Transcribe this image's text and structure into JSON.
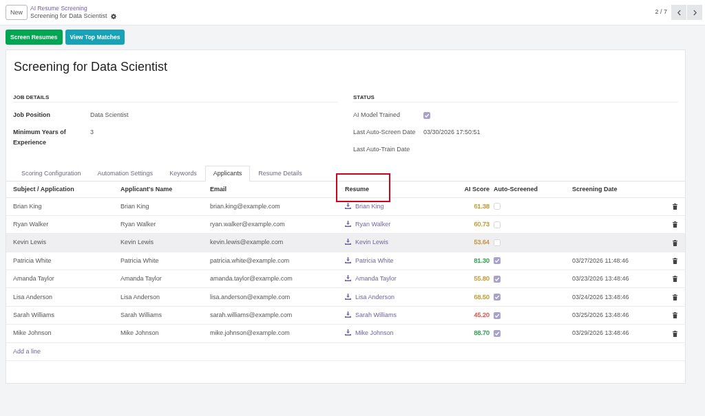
{
  "top_bar": {
    "new_button": "New",
    "breadcrumb": {
      "parent": "AI Resume Screening",
      "current": "Screening for Data Scientist"
    },
    "pager": "2 / 7"
  },
  "action_buttons": [
    {
      "label": "Screen Resumes",
      "kind": "success"
    },
    {
      "label": "View Top Matches",
      "kind": "info"
    }
  ],
  "form": {
    "title": "Screening for Data Scientist",
    "groups": [
      {
        "heading": "JOB DETAILS",
        "fields": [
          {
            "label": "Job Position",
            "kind": "text",
            "readonly": false,
            "value": "Data Scientist"
          },
          {
            "label": "Minimum Years of Experience",
            "kind": "text",
            "readonly": false,
            "value": "3"
          }
        ]
      },
      {
        "heading": "STATUS",
        "fields": [
          {
            "label": "AI Model Trained",
            "kind": "checkbox",
            "readonly": true,
            "checked": true
          },
          {
            "label": "Last Auto-Screen Date",
            "kind": "text",
            "readonly": true,
            "value": "03/30/2026 17:50:51"
          },
          {
            "label": "Last Auto-Train Date",
            "kind": "text",
            "readonly": true
          }
        ]
      }
    ],
    "tabs": [
      {
        "label": "Scoring Configuration",
        "selected": false
      },
      {
        "label": "Automation Settings",
        "selected": false
      },
      {
        "label": "Keywords",
        "selected": false
      },
      {
        "label": "Applicants",
        "selected": true
      },
      {
        "label": "Resume Details",
        "selected": false
      }
    ],
    "table": {
      "columns": [
        {
          "label": "Subject / Application",
          "kind": "text",
          "highlighted": false
        },
        {
          "label": "Applicant's Name",
          "kind": "text",
          "highlighted": false
        },
        {
          "label": "Email",
          "kind": "text",
          "highlighted": false
        },
        {
          "label": "Resume",
          "kind": "file",
          "highlighted": true
        },
        {
          "label": "AI Score",
          "kind": "score",
          "highlighted": false
        },
        {
          "label": "Auto-Screened",
          "kind": "checkbox",
          "highlighted": false
        },
        {
          "label": "Screening Date",
          "kind": "datetime",
          "highlighted": false
        }
      ],
      "rows": [
        {
          "subject": "Brian King",
          "applicant_name": "Brian King",
          "email": "brian.king@example.com",
          "resume": "Brian King",
          "ai_score": "61.38",
          "color": "#bf9a30",
          "auto_screened": false,
          "highlighted": false
        },
        {
          "subject": "Ryan Walker",
          "applicant_name": "Ryan Walker",
          "email": "ryan.walker@example.com",
          "resume": "Ryan Walker",
          "ai_score": "60.73",
          "color": "#bf9a30",
          "auto_screened": false,
          "highlighted": false
        },
        {
          "subject": "Kevin Lewis",
          "applicant_name": "Kevin Lewis",
          "email": "kevin.lewis@example.com",
          "resume": "Kevin Lewis",
          "ai_score": "53.64",
          "color": "#c8903a",
          "auto_screened": false,
          "highlighted": true
        },
        {
          "subject": "Patricia White",
          "applicant_name": "Patricia White",
          "email": "patricia.white@example.com",
          "resume": "Patricia White",
          "ai_score": "81.30",
          "color": "#2e9e4f",
          "auto_screened": true,
          "screening_date": "03/27/2026 11:48:46",
          "highlighted": false
        },
        {
          "subject": "Amanda Taylor",
          "applicant_name": "Amanda Taylor",
          "email": "amanda.taylor@example.com",
          "resume": "Amanda Taylor",
          "ai_score": "55.80",
          "color": "#bf9a30",
          "auto_screened": true,
          "screening_date": "03/23/2026 13:48:46",
          "highlighted": false
        },
        {
          "subject": "Lisa Anderson",
          "applicant_name": "Lisa Anderson",
          "email": "lisa.anderson@example.com",
          "resume": "Lisa Anderson",
          "ai_score": "68.50",
          "color": "#bf9a30",
          "auto_screened": true,
          "screening_date": "03/24/2026 13:48:46",
          "highlighted": false
        },
        {
          "subject": "Sarah Williams",
          "applicant_name": "Sarah Williams",
          "email": "sarah.williams@example.com",
          "resume": "Sarah Williams",
          "ai_score": "45.20",
          "color": "#d9534f",
          "auto_screened": true,
          "screening_date": "03/25/2026 13:48:46",
          "highlighted": false
        },
        {
          "subject": "Mike Johnson",
          "applicant_name": "Mike Johnson",
          "email": "mike.johnson@example.com",
          "resume": "Mike Johnson",
          "ai_score": "88.70",
          "color": "#2e9e4f",
          "auto_screened": true,
          "screening_date": "03/29/2026 13:48:46",
          "highlighted": false
        }
      ],
      "add_line": "Add a line"
    }
  }
}
